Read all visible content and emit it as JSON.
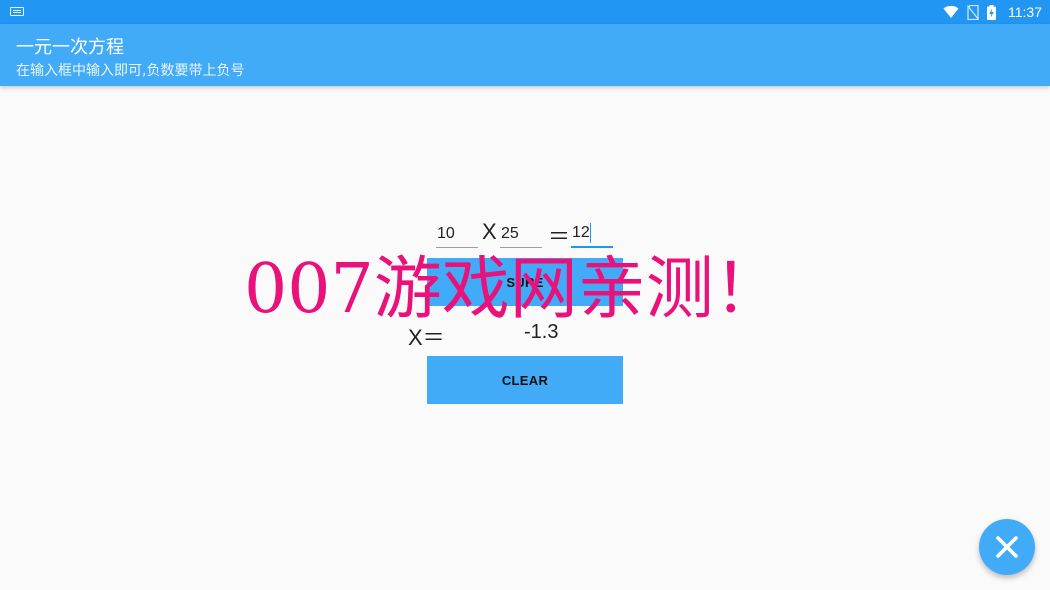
{
  "status_bar": {
    "time": "11:37",
    "icons": [
      "keyboard-icon",
      "wifi-icon",
      "no-sim-icon",
      "battery-charging-icon"
    ]
  },
  "app_bar": {
    "title": "一元一次方程",
    "subtitle": "在输入框中输入即可,负数要带上负号"
  },
  "equation": {
    "coefficient_a": "10",
    "multiply_sign": "X",
    "coefficient_b": "25",
    "equals_sign": "＝",
    "result_c": "12"
  },
  "buttons": {
    "sure_label": "SURE",
    "clear_label": "CLEAR"
  },
  "result": {
    "label": "X＝",
    "value": "-1.3"
  },
  "watermark": {
    "text": "007游戏网亲测！"
  },
  "fab": {
    "icon": "close-icon"
  },
  "colors": {
    "status_bar": "#2196F3",
    "app_bar": "#42ABF8",
    "button": "#42ABF8",
    "watermark": "#E8127A"
  }
}
